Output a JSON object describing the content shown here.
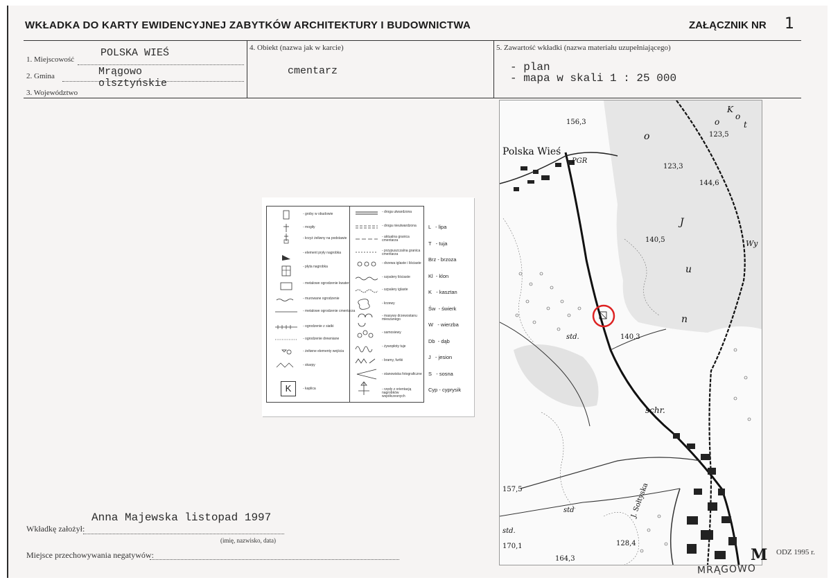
{
  "header": {
    "title": "WKŁADKA DO KARTY EWIDENCYJNEJ ZABYTKÓW ARCHITEKTURY I BUDOWNICTWA",
    "annex_label": "ZAŁĄCZNIK NR",
    "annex_number": "1"
  },
  "fields": {
    "miejscowosc_label": "1. Miejscowość",
    "miejscowosc_value": "POLSKA WIEŚ",
    "gmina_label": "2. Gmina",
    "gmina_value": "Mrągowo",
    "wojewodztwo_label": "3. Województwo",
    "wojewodztwo_value": "olsztyńskie",
    "obiekt_label": "4. Obiekt  (nazwa jak w karcie)",
    "obiekt_value": "cmentarz",
    "zawartosc_label": "5. Zawartość wkładki  (nazwa materiału uzupełniającego)",
    "zawartosc_line1": "- plan",
    "zawartosc_line2": "- mapa w skali 1 : 25 000"
  },
  "legend": {
    "left_items": [
      "- groby w obudowie",
      "- mogiły",
      "- krzyż żeliwny na podstawie",
      "- element pryły nagrobka",
      "- płyta nagrobka",
      "- metalowe ogrodzenie kwater",
      "- murowane ogrodzenie",
      "- metalowe ogrodzenie cmentarza",
      "- ogrodzenie z siatki",
      "- ogrodzenie drewniane",
      "- żeliwne elementy wejścia",
      "- skarpy",
      "- kaplica"
    ],
    "right_items": [
      "- droga utwardzona",
      "- droga nieutwardzona",
      "- aktualna granica cmentarza",
      "- przypuszczalna granica cmentarza",
      "- drzewa iglaste i liściaste",
      "- szpalery liściaste",
      "- szpalery iglaste",
      "- krzewy",
      "- masywy drzewostanu mieszanego",
      "- samosiewy",
      "- żywopłoty tuje",
      "- bramy, furtki",
      "- stanowiska fotograficzne",
      "- rzędy z orientacją nagrobków współczesnych"
    ],
    "chapel_symbol": "K",
    "trees": [
      "L   - lipa",
      "T   - tuja",
      "Brz - brzoza",
      "Kl  - klon",
      "K   - kasztan",
      "Św  - świerk",
      "W   - wierzba",
      "Db  - dąb",
      "J   - jesion",
      "S   - sosna",
      "Cyp - cyprysik"
    ]
  },
  "map": {
    "labels": {
      "village": "Polska Wieś",
      "pgr": "PGR",
      "h1": "156,3",
      "h2": "123,5",
      "h3": "123,3",
      "h4": "144,6",
      "h5": "140,5",
      "h6": "140,3",
      "h7": "157,5",
      "h8": "128,4",
      "h9": "164,3",
      "h10": "170,1",
      "std1": "std.",
      "std2": "std",
      "std3": "std.",
      "schr": "schr.",
      "lake_letters": [
        "o",
        "J",
        "u",
        "n",
        "o",
        "K",
        "o",
        "t"
      ],
      "wy": "Wy",
      "street": "J. Sołtyska"
    },
    "credit": "ODZ 1995 r.",
    "credit_mark": "M",
    "town_stamp": "MRĄGOWO"
  },
  "footer": {
    "prepared_label": "Wkładkę założył:",
    "prepared_value": "Anna Majewska  listopad 1997",
    "prepared_hint": "(imię, nazwisko, data)",
    "negatives_label": "Miejsce przechowywania negatywów:"
  }
}
